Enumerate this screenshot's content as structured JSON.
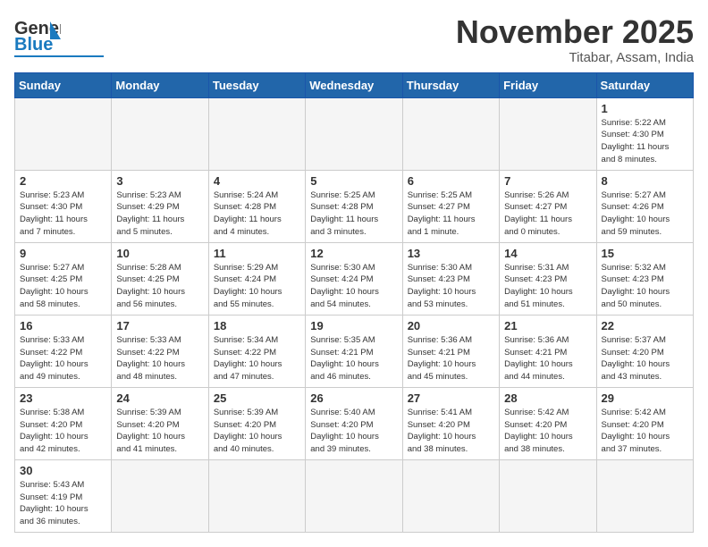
{
  "header": {
    "logo_general": "General",
    "logo_blue": "Blue",
    "month_title": "November 2025",
    "subtitle": "Titabar, Assam, India"
  },
  "weekdays": [
    "Sunday",
    "Monday",
    "Tuesday",
    "Wednesday",
    "Thursday",
    "Friday",
    "Saturday"
  ],
  "weeks": [
    [
      {
        "day": "",
        "info": ""
      },
      {
        "day": "",
        "info": ""
      },
      {
        "day": "",
        "info": ""
      },
      {
        "day": "",
        "info": ""
      },
      {
        "day": "",
        "info": ""
      },
      {
        "day": "",
        "info": ""
      },
      {
        "day": "1",
        "info": "Sunrise: 5:22 AM\nSunset: 4:30 PM\nDaylight: 11 hours\nand 8 minutes."
      }
    ],
    [
      {
        "day": "2",
        "info": "Sunrise: 5:23 AM\nSunset: 4:30 PM\nDaylight: 11 hours\nand 7 minutes."
      },
      {
        "day": "3",
        "info": "Sunrise: 5:23 AM\nSunset: 4:29 PM\nDaylight: 11 hours\nand 5 minutes."
      },
      {
        "day": "4",
        "info": "Sunrise: 5:24 AM\nSunset: 4:28 PM\nDaylight: 11 hours\nand 4 minutes."
      },
      {
        "day": "5",
        "info": "Sunrise: 5:25 AM\nSunset: 4:28 PM\nDaylight: 11 hours\nand 3 minutes."
      },
      {
        "day": "6",
        "info": "Sunrise: 5:25 AM\nSunset: 4:27 PM\nDaylight: 11 hours\nand 1 minute."
      },
      {
        "day": "7",
        "info": "Sunrise: 5:26 AM\nSunset: 4:27 PM\nDaylight: 11 hours\nand 0 minutes."
      },
      {
        "day": "8",
        "info": "Sunrise: 5:27 AM\nSunset: 4:26 PM\nDaylight: 10 hours\nand 59 minutes."
      }
    ],
    [
      {
        "day": "9",
        "info": "Sunrise: 5:27 AM\nSunset: 4:25 PM\nDaylight: 10 hours\nand 58 minutes."
      },
      {
        "day": "10",
        "info": "Sunrise: 5:28 AM\nSunset: 4:25 PM\nDaylight: 10 hours\nand 56 minutes."
      },
      {
        "day": "11",
        "info": "Sunrise: 5:29 AM\nSunset: 4:24 PM\nDaylight: 10 hours\nand 55 minutes."
      },
      {
        "day": "12",
        "info": "Sunrise: 5:30 AM\nSunset: 4:24 PM\nDaylight: 10 hours\nand 54 minutes."
      },
      {
        "day": "13",
        "info": "Sunrise: 5:30 AM\nSunset: 4:23 PM\nDaylight: 10 hours\nand 53 minutes."
      },
      {
        "day": "14",
        "info": "Sunrise: 5:31 AM\nSunset: 4:23 PM\nDaylight: 10 hours\nand 51 minutes."
      },
      {
        "day": "15",
        "info": "Sunrise: 5:32 AM\nSunset: 4:23 PM\nDaylight: 10 hours\nand 50 minutes."
      }
    ],
    [
      {
        "day": "16",
        "info": "Sunrise: 5:33 AM\nSunset: 4:22 PM\nDaylight: 10 hours\nand 49 minutes."
      },
      {
        "day": "17",
        "info": "Sunrise: 5:33 AM\nSunset: 4:22 PM\nDaylight: 10 hours\nand 48 minutes."
      },
      {
        "day": "18",
        "info": "Sunrise: 5:34 AM\nSunset: 4:22 PM\nDaylight: 10 hours\nand 47 minutes."
      },
      {
        "day": "19",
        "info": "Sunrise: 5:35 AM\nSunset: 4:21 PM\nDaylight: 10 hours\nand 46 minutes."
      },
      {
        "day": "20",
        "info": "Sunrise: 5:36 AM\nSunset: 4:21 PM\nDaylight: 10 hours\nand 45 minutes."
      },
      {
        "day": "21",
        "info": "Sunrise: 5:36 AM\nSunset: 4:21 PM\nDaylight: 10 hours\nand 44 minutes."
      },
      {
        "day": "22",
        "info": "Sunrise: 5:37 AM\nSunset: 4:20 PM\nDaylight: 10 hours\nand 43 minutes."
      }
    ],
    [
      {
        "day": "23",
        "info": "Sunrise: 5:38 AM\nSunset: 4:20 PM\nDaylight: 10 hours\nand 42 minutes."
      },
      {
        "day": "24",
        "info": "Sunrise: 5:39 AM\nSunset: 4:20 PM\nDaylight: 10 hours\nand 41 minutes."
      },
      {
        "day": "25",
        "info": "Sunrise: 5:39 AM\nSunset: 4:20 PM\nDaylight: 10 hours\nand 40 minutes."
      },
      {
        "day": "26",
        "info": "Sunrise: 5:40 AM\nSunset: 4:20 PM\nDaylight: 10 hours\nand 39 minutes."
      },
      {
        "day": "27",
        "info": "Sunrise: 5:41 AM\nSunset: 4:20 PM\nDaylight: 10 hours\nand 38 minutes."
      },
      {
        "day": "28",
        "info": "Sunrise: 5:42 AM\nSunset: 4:20 PM\nDaylight: 10 hours\nand 38 minutes."
      },
      {
        "day": "29",
        "info": "Sunrise: 5:42 AM\nSunset: 4:20 PM\nDaylight: 10 hours\nand 37 minutes."
      }
    ],
    [
      {
        "day": "30",
        "info": "Sunrise: 5:43 AM\nSunset: 4:19 PM\nDaylight: 10 hours\nand 36 minutes."
      },
      {
        "day": "",
        "info": ""
      },
      {
        "day": "",
        "info": ""
      },
      {
        "day": "",
        "info": ""
      },
      {
        "day": "",
        "info": ""
      },
      {
        "day": "",
        "info": ""
      },
      {
        "day": "",
        "info": ""
      }
    ]
  ]
}
